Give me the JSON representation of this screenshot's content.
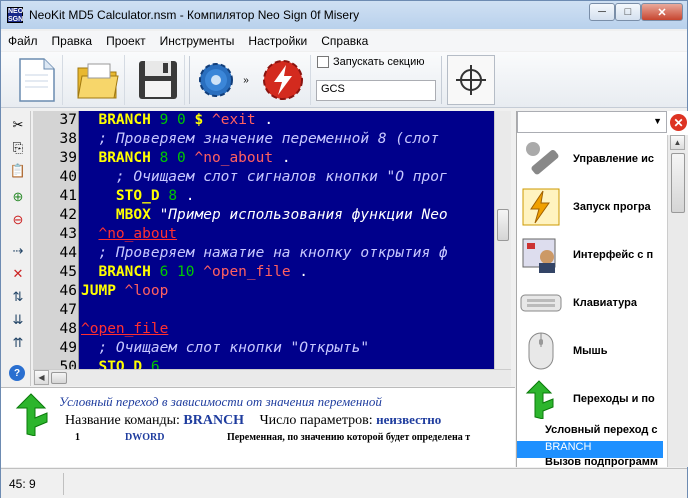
{
  "window": {
    "title": "NeoKit MD5 Calculator.nsm - Компилятор Neo Sign 0f Misery",
    "app_icon_text": "NEO SGN",
    "minimize": "─",
    "maximize": "□",
    "close": "✕"
  },
  "menu": [
    "Файл",
    "Правка",
    "Проект",
    "Инструменты",
    "Настройки",
    "Справка"
  ],
  "toolbar": {
    "run_section_label": "Запускать секцию",
    "section_value": "GCS"
  },
  "editor": {
    "lines": [
      {
        "n": "37",
        "indent": "  ",
        "parts": [
          [
            "kw",
            "BRANCH"
          ],
          [
            "t",
            " "
          ],
          [
            "num",
            "9 0"
          ],
          [
            "t",
            " "
          ],
          [
            "kw",
            "$"
          ],
          [
            "t",
            " "
          ],
          [
            "lbl",
            "^exit"
          ],
          [
            "t",
            " ."
          ]
        ]
      },
      {
        "n": "38",
        "indent": "  ",
        "parts": [
          [
            "cm",
            "; Проверяем значение переменной 8 (слот"
          ]
        ]
      },
      {
        "n": "39",
        "indent": "  ",
        "parts": [
          [
            "kw",
            "BRANCH"
          ],
          [
            "t",
            " "
          ],
          [
            "num",
            "8 0"
          ],
          [
            "t",
            " "
          ],
          [
            "lbl",
            "^no_about"
          ],
          [
            "t",
            " ."
          ]
        ]
      },
      {
        "n": "40",
        "indent": "    ",
        "parts": [
          [
            "cm",
            "; Очищаем слот сигналов кнопки \"О прог"
          ]
        ]
      },
      {
        "n": "41",
        "indent": "    ",
        "parts": [
          [
            "kw",
            "STO_D"
          ],
          [
            "t",
            " "
          ],
          [
            "num",
            "8"
          ],
          [
            "t",
            " ."
          ]
        ]
      },
      {
        "n": "42",
        "indent": "    ",
        "parts": [
          [
            "kw",
            "MBOX"
          ],
          [
            "t",
            " "
          ],
          [
            "str",
            "\"Пример использования функции Neo"
          ]
        ]
      },
      {
        "n": "43",
        "indent": "  ",
        "parts": [
          [
            "lbld",
            "^no_about"
          ]
        ]
      },
      {
        "n": "44",
        "indent": "  ",
        "parts": [
          [
            "cm",
            "; Проверяем нажатие на кнопку открытия ф"
          ]
        ]
      },
      {
        "n": "45",
        "indent": "  ",
        "parts": [
          [
            "kw",
            "BRANCH"
          ],
          [
            "t",
            " "
          ],
          [
            "num",
            "6 10"
          ],
          [
            "t",
            " "
          ],
          [
            "lbl",
            "^open_file"
          ],
          [
            "t",
            " ."
          ]
        ]
      },
      {
        "n": "46",
        "indent": "",
        "parts": [
          [
            "kw",
            "JUMP"
          ],
          [
            "t",
            " "
          ],
          [
            "lbl",
            "^loop"
          ]
        ]
      },
      {
        "n": "47",
        "indent": "",
        "parts": []
      },
      {
        "n": "48",
        "indent": "",
        "parts": [
          [
            "lbld",
            "^open_file"
          ]
        ]
      },
      {
        "n": "49",
        "indent": "  ",
        "parts": [
          [
            "cm",
            "; Очищаем слот кнопки \"Открыть\""
          ]
        ]
      },
      {
        "n": "50",
        "indent": "  ",
        "parts": [
          [
            "kw",
            "STO_D"
          ],
          [
            "t",
            " "
          ],
          [
            "num",
            "6"
          ]
        ]
      }
    ]
  },
  "right_panel": {
    "items": [
      "Управление ис",
      "Запуск програ",
      "Интерфейс с п",
      "Клавиатура",
      "Мышь",
      "Переходы и по"
    ],
    "sub_items": [
      "Условный переход с",
      "BRANCH",
      "Вызов подпрограмм"
    ]
  },
  "bottom": {
    "description": "Условный переход в зависимости от значения переменной",
    "command_name_label": "Название команды:",
    "command_name": "BRANCH",
    "param_count_label": "Число параметров:",
    "param_count": "неизвестно",
    "param_index": "1",
    "param_type": "DWORD",
    "param_desc": "Переменная, по значению которой будет определена т"
  },
  "status": {
    "position": "45:  9"
  },
  "colors": {
    "editor_bg": "#00008b",
    "keyword": "#ffff00",
    "number": "#00c800",
    "label": "#ff6060",
    "comment": "#c8c8ff",
    "selection": "#1e90ff"
  }
}
